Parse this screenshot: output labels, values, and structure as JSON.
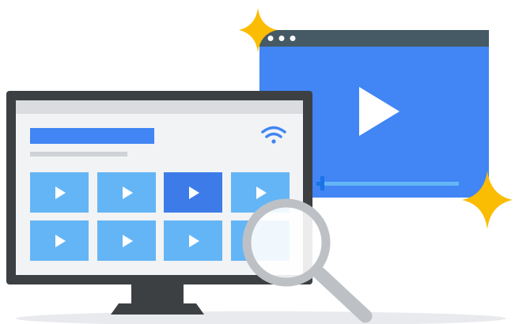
{
  "illustration": {
    "icons": {
      "monitor": "monitor-icon",
      "video_window": "video-player-window-icon",
      "play": "play-icon",
      "wifi": "wifi-icon",
      "magnifier": "magnifying-glass-icon",
      "sparkle": "sparkle-icon"
    },
    "colors": {
      "blue_primary": "#4285f4",
      "blue_light": "#64b5f6",
      "blue_selected": "#3d7be8",
      "title_bar_dark": "#455a64",
      "monitor_frame": "#3c4043",
      "screen_bg": "#f1f3f4",
      "screen_header": "#dadce0",
      "gray_line": "#cfd2d6",
      "sparkle_yellow": "#fbbc04",
      "magnifier_gray": "#bdc1c6",
      "shadow": "#e8eaed",
      "white": "#ffffff"
    },
    "video_player": {
      "window_control_dots": 3,
      "progress": 0.03
    },
    "thumbnail_grid": {
      "rows": 2,
      "columns": 4,
      "selected_index": 2
    }
  }
}
